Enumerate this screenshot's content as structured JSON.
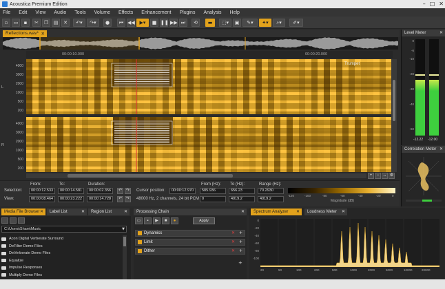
{
  "app": {
    "title": "Acoustica Premium Edition"
  },
  "menu": [
    "File",
    "Edit",
    "View",
    "Audio",
    "Tools",
    "Volume",
    "Effects",
    "Enhancement",
    "Plugins",
    "Analysis",
    "Help"
  ],
  "document_tab": {
    "label": "Reflections.wav*"
  },
  "timeline": {
    "ticks": [
      "00:00:10.000",
      "00:00:20.000"
    ]
  },
  "spectrogram": {
    "freq_ticks": [
      "4000",
      "3000",
      "2000",
      "1000",
      "500",
      "200"
    ],
    "channel_labels": [
      "L",
      "R"
    ],
    "track_label": "Trumpet"
  },
  "selection": {
    "row_labels": [
      "Selection:",
      "View:"
    ],
    "col_labels": [
      "From:",
      "To:",
      "Duration:"
    ],
    "selection_values": [
      "00:00:12.533",
      "00:00:14.581",
      "00:00:02.356"
    ],
    "view_values": [
      "00:00:08.464",
      "00:00:23.222",
      "00:00:14.728"
    ],
    "cursor_label": "Cursor position:",
    "cursor_value": "00:00:12.970",
    "format": "48000 Hz, 2 channels, 24 bit PCM",
    "freq_col_labels": [
      "From (Hz):",
      "To (Hz):",
      "Range (Hz):"
    ],
    "freq_row1": [
      "585.936",
      "656.23",
      "70.2930"
    ],
    "freq_row2": [
      "0",
      "4019.2",
      "4019.2"
    ],
    "colorbar_ticks": [
      "-120",
      "-100",
      "-80",
      "-60",
      "-40",
      "-20",
      "0"
    ],
    "colorbar_caption": "Magnitude (dB)"
  },
  "level_meter": {
    "title": "Level Meter",
    "scale": [
      "0",
      "-6",
      "-10",
      "-20",
      "-30",
      "-40",
      "-60"
    ],
    "left_value": "-12.22",
    "right_value": "-12.00",
    "left_level": 0.58,
    "right_level": 0.58
  },
  "correlation_meter": {
    "title": "Correlation Meter"
  },
  "bottom_tabs": {
    "media_file_browser": "Media File Browser",
    "label_list": "Label List",
    "region_list": "Region List",
    "processing_chain": "Processing Chain",
    "spectrum_analyzer": "Spectrum Analyzer",
    "loudness_meter": "Loudness Meter"
  },
  "media_browser": {
    "path": "C:\\Users\\Sham\\Music",
    "items": [
      "Acon Digital Verberate Surround",
      "DeFilter Demo Files",
      "DeVerberate Demo Files",
      "Equalize",
      "Impulse Responses",
      "Multiply Demo Files"
    ]
  },
  "processing_chain": {
    "apply_label": "Apply",
    "items": [
      "Dynamics",
      "Limit",
      "Dither"
    ]
  },
  "spectrum_analyzer": {
    "x_ticks": [
      "20",
      "50",
      "100",
      "200",
      "500",
      "1000",
      "2000",
      "5000",
      "10000",
      "20000"
    ],
    "y_ticks": [
      "0",
      "-20",
      "-40",
      "-60",
      "-80",
      "-100"
    ]
  },
  "colors": {
    "accent": "#e2a21c",
    "meter_green": "#3ecf3e",
    "spectro": "#e8b030"
  }
}
